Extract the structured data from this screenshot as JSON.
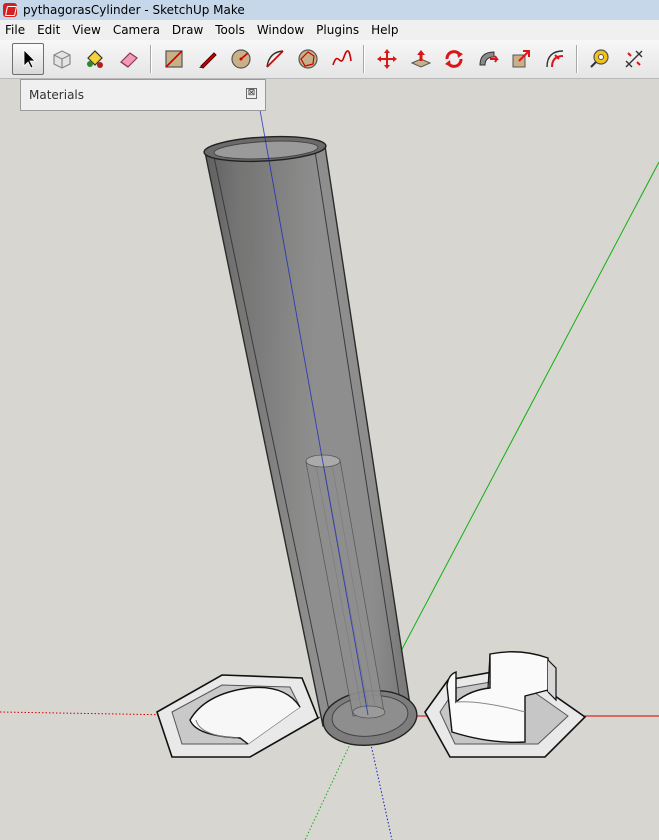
{
  "window": {
    "title": "pythagorasCylinder - SketchUp Make"
  },
  "menu": [
    "File",
    "Edit",
    "View",
    "Camera",
    "Draw",
    "Tools",
    "Window",
    "Plugins",
    "Help"
  ],
  "toolbar": {
    "groups": [
      [
        "select-tool",
        "make-component-tool",
        "paint-bucket-tool",
        "eraser-tool"
      ],
      [
        "rectangle-tool",
        "line-tool",
        "circle-tool",
        "arc-tool",
        "polygon-tool",
        "freehand-tool"
      ],
      [
        "move-tool",
        "push-pull-tool",
        "rotate-tool",
        "follow-me-tool",
        "scale-tool",
        "offset-tool"
      ],
      [
        "tape-measure-tool",
        "dimension-tool"
      ]
    ],
    "active": "select-tool"
  },
  "materials_panel": {
    "title": "Materials",
    "close_glyph": "⊠"
  },
  "colors": {
    "background": "#d7d6d1",
    "axis_red": "#d60000",
    "axis_green": "#12b012",
    "axis_blue": "#1020c0",
    "title_bar": "#c6d7ea"
  }
}
